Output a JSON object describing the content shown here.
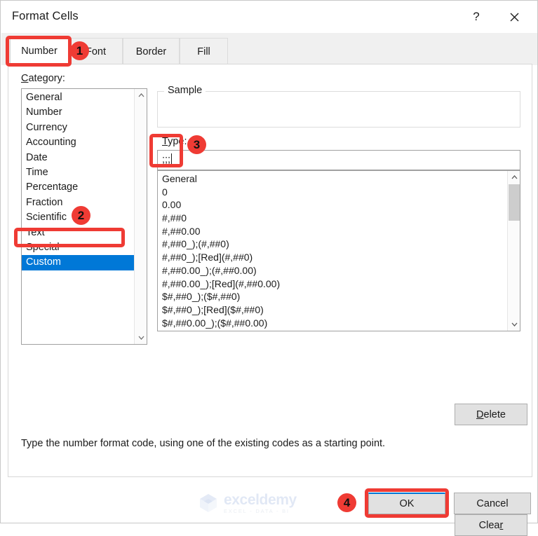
{
  "window": {
    "title": "Format Cells",
    "help_icon": "question-mark-icon",
    "close_icon": "close-icon"
  },
  "tabs": [
    {
      "label": "Number",
      "active": true
    },
    {
      "label": "Font",
      "active": false
    },
    {
      "label": "Border",
      "active": false
    },
    {
      "label": "Fill",
      "active": false
    }
  ],
  "category": {
    "label": "Category:",
    "accelerator": "C",
    "items": [
      "General",
      "Number",
      "Currency",
      "Accounting",
      "Date",
      "Time",
      "Percentage",
      "Fraction",
      "Scientific",
      "Text",
      "Special",
      "Custom"
    ],
    "selected": "Custom",
    "scroll_up_icon": "chevron-up-icon",
    "scroll_down_icon": "chevron-down-icon"
  },
  "sample": {
    "legend": "Sample",
    "value": ""
  },
  "type": {
    "label": "Type:",
    "accelerator": "T",
    "value": ";;;",
    "items": [
      "General",
      "0",
      "0.00",
      "#,##0",
      "#,##0.00",
      "#,##0_);(#,##0)",
      "#,##0_);[Red](#,##0)",
      "#,##0.00_);(#,##0.00)",
      "#,##0.00_);[Red](#,##0.00)",
      "$#,##0_);($#,##0)",
      "$#,##0_);[Red]($#,##0)",
      "$#,##0.00_);($#,##0.00)"
    ],
    "scroll_up_icon": "chevron-up-icon",
    "scroll_down_icon": "chevron-down-icon"
  },
  "buttons": {
    "delete": "Delete",
    "delete_accelerator": "D",
    "clear": "Clear",
    "clear_accelerator": "r",
    "ok": "OK",
    "cancel": "Cancel"
  },
  "hint": "Type the number format code, using one of the existing codes as a starting point.",
  "watermark": {
    "main": "exceldemy",
    "sub": "EXCEL - DATA - BI"
  },
  "annotations": [
    {
      "number": "1",
      "target": "number-tab"
    },
    {
      "number": "2",
      "target": "category-custom-item"
    },
    {
      "number": "3",
      "target": "type-input"
    },
    {
      "number": "4",
      "target": "ok-button"
    }
  ],
  "colors": {
    "accent": "#0078d7",
    "annotation": "#ef3b34",
    "selection": "#0078d7",
    "button_face": "#e1e1e1"
  }
}
